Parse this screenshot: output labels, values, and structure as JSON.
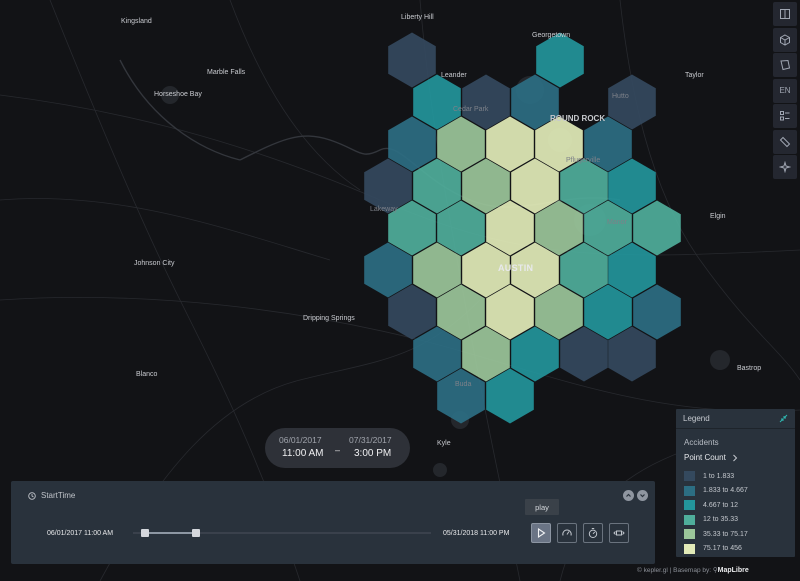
{
  "map": {
    "city_labels": [
      {
        "name": "Kingsland",
        "key": "kingsland"
      },
      {
        "name": "Liberty Hill",
        "key": "liberty-hill"
      },
      {
        "name": "Georgetown",
        "key": "georgetown"
      },
      {
        "name": "Marble Falls",
        "key": "marble-falls"
      },
      {
        "name": "Leander",
        "key": "leander"
      },
      {
        "name": "Taylor",
        "key": "taylor"
      },
      {
        "name": "Horseshoe Bay",
        "key": "horseshoe-bay"
      },
      {
        "name": "Cedar Park",
        "key": "cedar-park"
      },
      {
        "name": "Hutto",
        "key": "hutto"
      },
      {
        "name": "ROUND ROCK",
        "key": "round-rock"
      },
      {
        "name": "Pflugerville",
        "key": "pflugerville"
      },
      {
        "name": "Lakeway",
        "key": "lakeway"
      },
      {
        "name": "Elgin",
        "key": "elgin"
      },
      {
        "name": "Manor",
        "key": "manor"
      },
      {
        "name": "Johnson City",
        "key": "johnson-city"
      },
      {
        "name": "AUSTIN",
        "key": "austin"
      },
      {
        "name": "Dripping Springs",
        "key": "dripping-springs"
      },
      {
        "name": "Blanco",
        "key": "blanco"
      },
      {
        "name": "Buda",
        "key": "buda"
      },
      {
        "name": "Bastrop",
        "key": "bastrop"
      },
      {
        "name": "Kyle",
        "key": "kyle"
      }
    ]
  },
  "toolbar": {
    "buttons": [
      {
        "name": "split-map-button",
        "icon": "split-map-icon"
      },
      {
        "name": "3d-view-button",
        "icon": "cube-icon"
      },
      {
        "name": "draw-button",
        "icon": "polygon-icon"
      },
      {
        "name": "language-button",
        "icon": "",
        "label": "EN"
      },
      {
        "name": "legend-toggle-button",
        "icon": "legend-icon"
      },
      {
        "name": "ruler-button",
        "icon": "ruler-icon"
      },
      {
        "name": "ai-assistant-button",
        "icon": "sparkle-icon"
      }
    ]
  },
  "time_range": {
    "start_date": "06/01/2017",
    "start_time": "11:00 AM",
    "separator": "–",
    "end_date": "07/31/2017",
    "end_time": "3:00 PM"
  },
  "animation": {
    "title": "StartTime",
    "domain_start": "06/01/2017 11:00 AM",
    "domain_end": "05/31/2018 11:00 PM",
    "range_start_fraction": 0.0,
    "range_end_fraction": 0.17,
    "tooltip": "play",
    "controls": [
      {
        "name": "play-button",
        "icon": "play-icon",
        "active": true
      },
      {
        "name": "speed-button",
        "icon": "speedometer-icon",
        "active": false
      },
      {
        "name": "timer-button",
        "icon": "timer-icon",
        "active": false
      },
      {
        "name": "window-button",
        "icon": "window-icon",
        "active": false
      }
    ]
  },
  "legend": {
    "title": "Legend",
    "layer_name": "Accidents",
    "field": "Point Count",
    "rows": [
      {
        "label": "1 to 1.833",
        "color": "#34495e"
      },
      {
        "label": "1.833 to 4.667",
        "color": "#2c6e83"
      },
      {
        "label": "4.667 to 12",
        "color": "#23959b"
      },
      {
        "label": "12 to 35.33",
        "color": "#4fae9b"
      },
      {
        "label": "35.33 to 75.17",
        "color": "#9bc69a"
      },
      {
        "label": "75.17 to 456",
        "color": "#e2ebb8"
      }
    ]
  },
  "attribution": {
    "prefix": "© kepler.gl | Basemap by:",
    "brand": "MapLibre"
  }
}
